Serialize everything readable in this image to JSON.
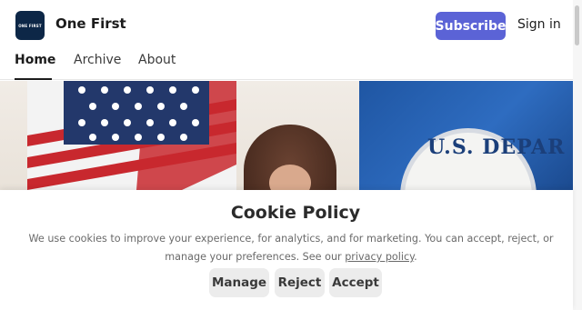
{
  "header": {
    "logo_text": "ONE FIRST",
    "publication_name": "One First",
    "subscribe_label": "Subscribe",
    "signin_label": "Sign in",
    "accent_color": "#5b63d6"
  },
  "nav": {
    "tabs": [
      {
        "label": "Home",
        "active": true
      },
      {
        "label": "Archive",
        "active": false
      },
      {
        "label": "About",
        "active": false
      }
    ]
  },
  "hero": {
    "seal_text": "U.S. DEPAR"
  },
  "cookie_banner": {
    "title": "Cookie Policy",
    "text_before_link": "We use cookies to improve your experience, for analytics, and for marketing. You can accept, reject, or manage your preferences. See our ",
    "link_text": "privacy policy",
    "text_after_link": ".",
    "buttons": {
      "manage": "Manage",
      "reject": "Reject",
      "accept": "Accept"
    }
  }
}
